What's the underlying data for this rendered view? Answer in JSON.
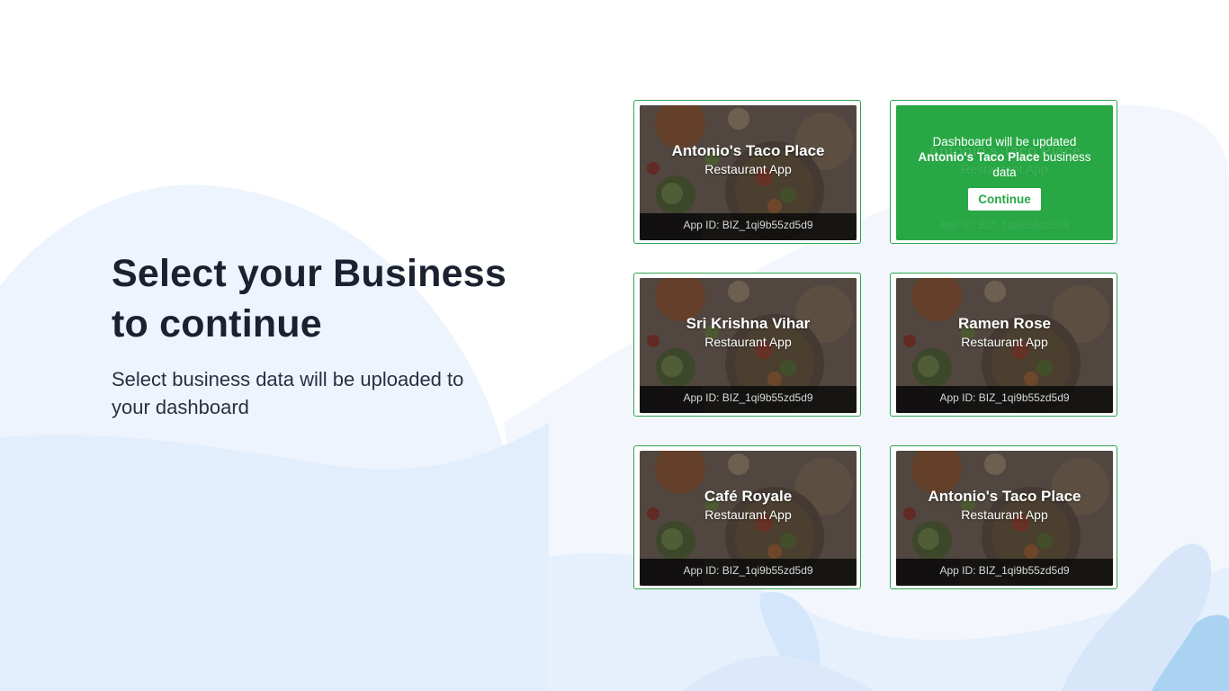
{
  "page": {
    "heading_line1": "Select your Business",
    "heading_line2": "to continue",
    "subtitle": "Select business data will be uploaded to your dashboard"
  },
  "colors": {
    "accent": "#28a745",
    "card_border": "#2da44e",
    "heading": "#1c2130",
    "background_blob": "#e8f1fd"
  },
  "businesses": [
    {
      "name": "Antonio's Taco Place",
      "type": "Restaurant App",
      "app_id": "App ID: BIZ_1qi9b55zd5d9"
    },
    {
      "name": "Antonio's Taco Place",
      "type": "Restaurant App",
      "app_id": "App ID: BIZ_1qi9b55zd5d9",
      "selected": true
    },
    {
      "name": "Sri Krishna Vihar",
      "type": "Restaurant App",
      "app_id": "App ID: BIZ_1qi9b55zd5d9"
    },
    {
      "name": "Ramen Rose",
      "type": "Restaurant App",
      "app_id": "App ID: BIZ_1qi9b55zd5d9"
    },
    {
      "name": "Café Royale",
      "type": "Restaurant App",
      "app_id": "App ID: BIZ_1qi9b55zd5d9"
    },
    {
      "name": "Antonio's Taco Place",
      "type": "Restaurant App",
      "app_id": "App ID: BIZ_1qi9b55zd5d9"
    }
  ],
  "confirm": {
    "line_prefix": "Dashboard will be updated",
    "business_name": "Antonio's Taco Place",
    "line_suffix": "business data",
    "continue_label": "Continue"
  },
  "icons": {
    "card_image": "food-bowl-image"
  }
}
